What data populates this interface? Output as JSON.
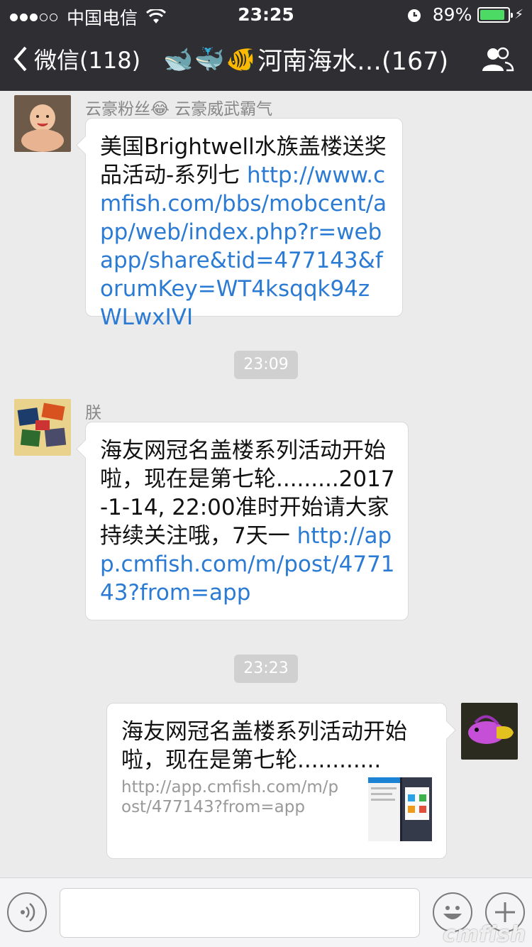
{
  "status_bar": {
    "carrier": "中国电信",
    "time": "23:25",
    "battery": "89%"
  },
  "nav": {
    "back_label": "微信(118)",
    "title_emoji": [
      "🐋",
      "🐳",
      "🐠"
    ],
    "title": "河南海水…(167)"
  },
  "messages": [
    {
      "sender": "云豪粉丝😂 云豪威武霸气",
      "text": "美国Brightwell水族盖楼送奖品活动-系列七 ",
      "link": "http://www.cmfish.com/bbs/mobcent/app/web/index.php?r=webapp/share&tid=477143&forumKey=WT4ksqqk94zWLwxIVI"
    },
    {
      "time": "23:09"
    },
    {
      "sender": "朕",
      "text": "海友网冠名盖楼系列活动开始啦，现在是第七轮.........2017-1-14, 22:00准时开始请大家持续关注哦，7天一 ",
      "link": "http://app.cmfish.com/m/post/477143?from=app"
    },
    {
      "time": "23:23"
    },
    {
      "share_title": "海友网冠名盖楼系列活动开始啦，现在是第七轮............",
      "share_url": "http://app.cmfish.com/m/post/477143?from=app"
    }
  ],
  "input": {
    "placeholder": ""
  },
  "watermark": "cmfish"
}
